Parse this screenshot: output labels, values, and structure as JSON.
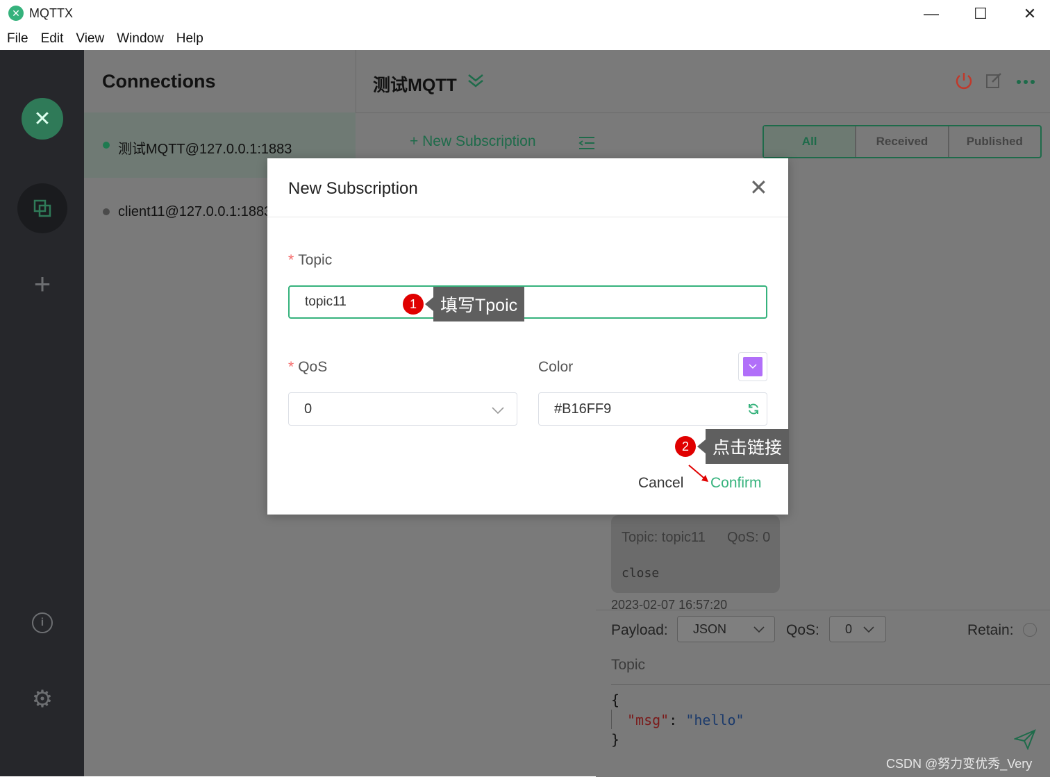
{
  "window": {
    "title": "MQTTX",
    "logo_glyph": "✕",
    "controls": {
      "minimize": "—",
      "maximize": "☐",
      "close": "✕"
    }
  },
  "menu": [
    "File",
    "Edit",
    "View",
    "Window",
    "Help"
  ],
  "sidebar": {
    "logo_glyph": "✕",
    "icons": [
      "connections-icon",
      "add-icon",
      "info-icon",
      "settings-icon"
    ],
    "add_glyph": "+",
    "info_glyph": "i",
    "gear_glyph": "⚙"
  },
  "connections": {
    "title": "Connections",
    "items": [
      {
        "label": "测试MQTT@127.0.0.1:1883",
        "status_color": "#1f7a50"
      },
      {
        "label": "client11@127.0.0.1:1883",
        "status_color": "#4b4b4b"
      }
    ]
  },
  "main": {
    "connection_name": "测试MQTT",
    "new_subscription": "+ New Subscription",
    "filters": [
      "All",
      "Received",
      "Published"
    ],
    "active_filter": "All",
    "message": {
      "topic": "Topic: topic11",
      "qos": "QoS: 0",
      "payload": "close",
      "time": "2023-02-07 16:57:20"
    },
    "composer": {
      "payload_label": "Payload:",
      "payload_format": "JSON",
      "qos_label": "QoS:",
      "qos_value": "0",
      "retain_label": "Retain:",
      "topic_placeholder": "Topic",
      "code_line1": "{",
      "code_key": "\"msg\"",
      "code_colon": ": ",
      "code_value": "\"hello\"",
      "code_line3": "}"
    }
  },
  "modal": {
    "title": "New Subscription",
    "close_glyph": "✕",
    "topic_label": "Topic",
    "topic_value": "topic11",
    "qos_label": "QoS",
    "qos_value": "0",
    "color_label": "Color",
    "color_value": "#B16FF9",
    "cancel": "Cancel",
    "confirm": "Confirm"
  },
  "annotations": [
    {
      "number": "1",
      "text": "填写Tpoic"
    },
    {
      "number": "2",
      "text": "点击链接"
    }
  ],
  "watermark": "CSDN @努力变优秀_Very",
  "colors": {
    "accent": "#35b27c",
    "swatch": "#B16FF9",
    "required": "#f56c6c",
    "badge": "#e00000",
    "disconnect": "#c0392b"
  }
}
